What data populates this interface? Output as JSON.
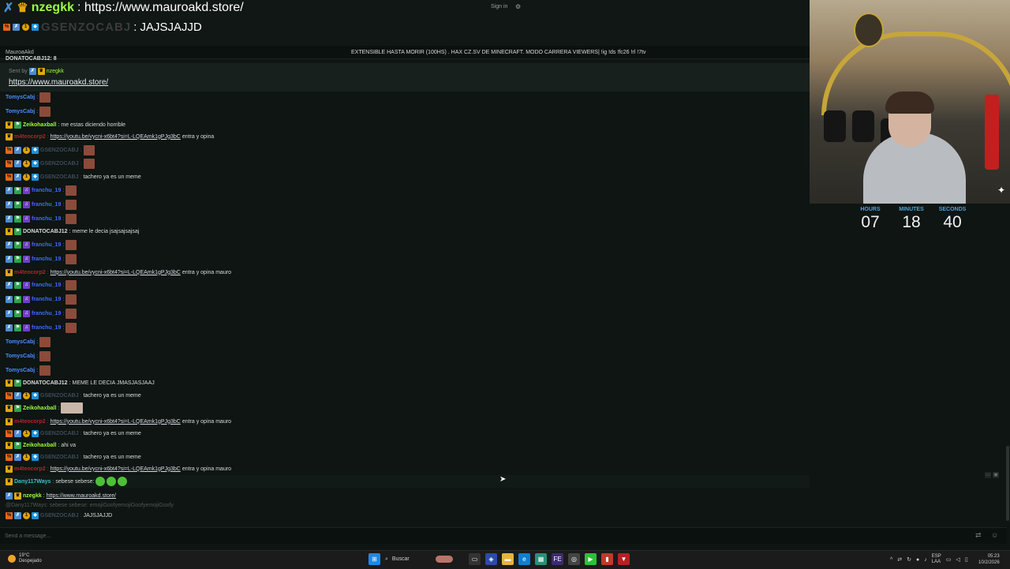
{
  "overlay": {
    "line1_user": "nzegkk",
    "line1_text": ": https://www.mauroakd.store/",
    "line2_user": "GSENZOCABJ",
    "line2_text": ": JAJSJAJJD",
    "signin": "Sign in"
  },
  "header": {
    "channel": "MauroaAkd",
    "title": "EXTENSIBLE HASTA MORIR (100HS) . HAX CZ.SV DE MINECRAFT. MODO CARRERA VIEWERS| !ig !ds !fc26 !rl !7tv"
  },
  "partial_top": "DONATOCABJ12: 8",
  "pinned": {
    "sent_by": "Sent by",
    "sender": "nzegkk",
    "link": "https://www.mauroakd.store/"
  },
  "messages": [
    {
      "user": "TomysCabj",
      "color": "#4a8cff",
      "badges": [],
      "text": "",
      "link": "",
      "emote": "emote"
    },
    {
      "user": "TomysCabj",
      "color": "#4a8cff",
      "badges": [],
      "text": "",
      "link": "",
      "emote": "emote"
    },
    {
      "user": "Zeikohaxball",
      "color": "#9cff3c",
      "badges": [
        "crown",
        "mod"
      ],
      "text": "me estas diciendo horrible",
      "link": "",
      "emote": ""
    },
    {
      "user": "m4teocorp2",
      "color": "#b0242e",
      "badges": [
        "crown"
      ],
      "text": "entra y opina",
      "link": "https://youtu.be/vycni-x6bt4?si=L-LQEAmk1gPJg3bC",
      "emote": ""
    },
    {
      "user": "GSENZOCABJ",
      "color": "#3e4b5a",
      "badges": [
        "x",
        "sub",
        "one",
        "gift"
      ],
      "text": "",
      "link": "",
      "emote": "emote"
    },
    {
      "user": "GSENZOCABJ",
      "color": "#3e4b5a",
      "badges": [
        "x",
        "sub",
        "one",
        "gift"
      ],
      "text": "",
      "link": "",
      "emote": "emote"
    },
    {
      "user": "GSENZOCABJ",
      "color": "#3e4b5a",
      "badges": [
        "x",
        "sub",
        "one",
        "gift"
      ],
      "text": "tachero ya es un meme",
      "link": "",
      "emote": ""
    },
    {
      "user": "franchu_19",
      "color": "#3b6cff",
      "badges": [
        "sub",
        "mod",
        "art"
      ],
      "text": "",
      "link": "",
      "emote": "emote"
    },
    {
      "user": "franchu_19",
      "color": "#3b6cff",
      "badges": [
        "sub",
        "mod",
        "art"
      ],
      "text": "",
      "link": "",
      "emote": "emote"
    },
    {
      "user": "franchu_19",
      "color": "#3b6cff",
      "badges": [
        "sub",
        "mod",
        "art"
      ],
      "text": "",
      "link": "",
      "emote": "emote"
    },
    {
      "user": "DONATOCABJ12",
      "color": "#d8dcd9",
      "badges": [
        "crown",
        "mod"
      ],
      "text": "meme le decia jsajsajsajsaj",
      "link": "",
      "emote": ""
    },
    {
      "user": "franchu_19",
      "color": "#3b6cff",
      "badges": [
        "sub",
        "mod",
        "art"
      ],
      "text": "",
      "link": "",
      "emote": "emote"
    },
    {
      "user": "franchu_19",
      "color": "#3b6cff",
      "badges": [
        "sub",
        "mod",
        "art"
      ],
      "text": "",
      "link": "",
      "emote": "emote"
    },
    {
      "user": "m4teocorp2",
      "color": "#b0242e",
      "badges": [
        "crown"
      ],
      "text": "entra y opina mauro",
      "link": "https://youtu.be/vycni-x6bt4?si=L-LQEAmk1gPJg3bC",
      "emote": ""
    },
    {
      "user": "franchu_19",
      "color": "#3b6cff",
      "badges": [
        "sub",
        "mod",
        "art"
      ],
      "text": "",
      "link": "",
      "emote": "emote"
    },
    {
      "user": "franchu_19",
      "color": "#3b6cff",
      "badges": [
        "sub",
        "mod",
        "art"
      ],
      "text": "",
      "link": "",
      "emote": "emote"
    },
    {
      "user": "franchu_19",
      "color": "#3b6cff",
      "badges": [
        "sub",
        "mod",
        "art"
      ],
      "text": "",
      "link": "",
      "emote": "emote"
    },
    {
      "user": "franchu_19",
      "color": "#3b6cff",
      "badges": [
        "sub",
        "mod",
        "art"
      ],
      "text": "",
      "link": "",
      "emote": "emote"
    },
    {
      "user": "TomysCabj",
      "color": "#4a8cff",
      "badges": [],
      "text": "",
      "link": "",
      "emote": "emote"
    },
    {
      "user": "TomysCabj",
      "color": "#4a8cff",
      "badges": [],
      "text": "",
      "link": "",
      "emote": "emote"
    },
    {
      "user": "TomysCabj",
      "color": "#4a8cff",
      "badges": [],
      "text": "",
      "link": "",
      "emote": "emote"
    },
    {
      "user": "DONATOCABJ12",
      "color": "#d8dcd9",
      "badges": [
        "crown",
        "mod"
      ],
      "text": "MEME LE DECIA JMASJASJAAJ",
      "link": "",
      "emote": ""
    },
    {
      "user": "GSENZOCABJ",
      "color": "#3e4b5a",
      "badges": [
        "x",
        "sub",
        "one",
        "gift"
      ],
      "text": "tachero ya es un meme",
      "link": "",
      "emote": ""
    },
    {
      "user": "Zeikohaxball",
      "color": "#9cff3c",
      "badges": [
        "crown",
        "mod"
      ],
      "text": "",
      "link": "",
      "emote": "face"
    },
    {
      "user": "m4teocorp2",
      "color": "#b0242e",
      "badges": [
        "crown"
      ],
      "text": "entra y opina mauro",
      "link": "https://youtu.be/vycni-x6bt4?si=L-LQEAmk1gPJg3bC",
      "emote": ""
    },
    {
      "user": "GSENZOCABJ",
      "color": "#3e4b5a",
      "badges": [
        "x",
        "sub",
        "one",
        "gift"
      ],
      "text": "tachero ya es un meme",
      "link": "",
      "emote": ""
    },
    {
      "user": "Zeikohaxball",
      "color": "#9cff3c",
      "badges": [
        "crown",
        "mod"
      ],
      "text": "ahi va",
      "link": "",
      "emote": ""
    },
    {
      "user": "GSENZOCABJ",
      "color": "#3e4b5a",
      "badges": [
        "x",
        "sub",
        "one",
        "gift"
      ],
      "text": "tachero ya es un meme",
      "link": "",
      "emote": ""
    },
    {
      "user": "m4teocorp2",
      "color": "#b0242e",
      "badges": [
        "crown"
      ],
      "text": "entra y opina mauro",
      "link": "https://youtu.be/vycni-x6bt4?si=L-LQEAmk1gPJg3bC",
      "emote": ""
    },
    {
      "user": "Dany117Ways",
      "color": "#3fc0c9",
      "badges": [
        "crown"
      ],
      "text": "sebese sebese:",
      "link": "",
      "emote": "frogs"
    },
    {
      "user": "nzegkk",
      "color": "#9cff3c",
      "badges": [
        "sub",
        "crown"
      ],
      "text": "",
      "link": "https://www.mauroakd.store/",
      "emote": ""
    },
    {
      "user": "GSENZOCABJ",
      "color": "#3e4b5a",
      "badges": [
        "x",
        "sub",
        "one",
        "gift"
      ],
      "text": "JAJSJAJJD",
      "link": "",
      "emote": ""
    }
  ],
  "reply_preview": "@Dany117Ways: sebese sebese: emojiGoofyemojiGoofyemojiGoofy",
  "input": {
    "placeholder": "Send a message..."
  },
  "timer": {
    "hours_label": "HOURS",
    "hours": "07",
    "minutes_label": "MINUTES",
    "minutes": "18",
    "seconds_label": "SECONDS",
    "seconds": "40"
  },
  "taskbar": {
    "temp": "19°C",
    "weather": "Despejado",
    "search": "Buscar",
    "lang": "ESP",
    "lang2": "LAA",
    "time": "05:23",
    "date": "10/2/2026"
  }
}
